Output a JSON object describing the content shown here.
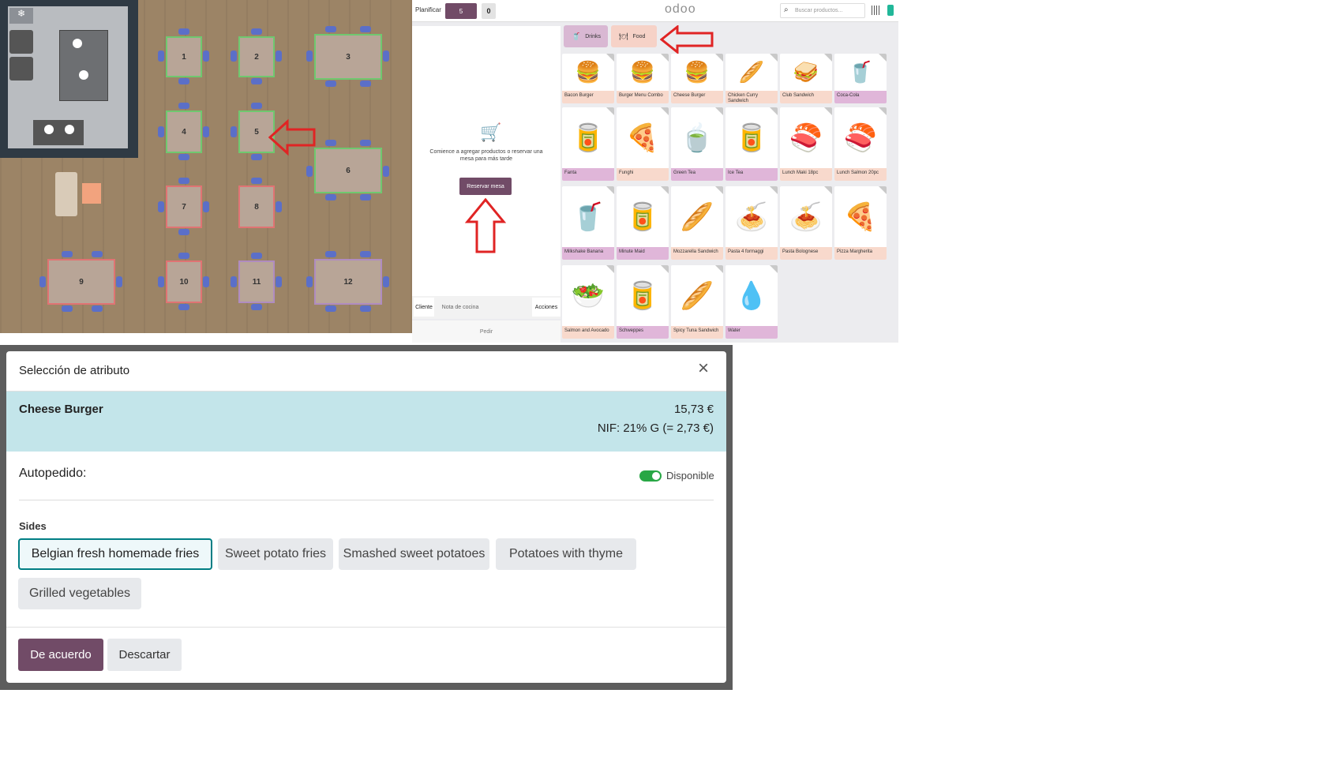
{
  "floor": {
    "tables": [
      "1",
      "2",
      "3",
      "4",
      "5",
      "6",
      "7",
      "8",
      "9",
      "10",
      "11",
      "12"
    ]
  },
  "pos": {
    "header": {
      "plan_label": "Planificar",
      "table_badge": "5",
      "counter_badge": "0",
      "logo": "odoo",
      "search_placeholder": "Buscar productos..."
    },
    "categories": [
      "Drinks",
      "Food"
    ],
    "empty_cart": {
      "message": "Comience a agregar productos o reservar una mesa para más tarde",
      "reserve_button": "Reservar mesa"
    },
    "actions": {
      "customer": "Cliente",
      "kitchen_note": "Nota de cocina",
      "actions": "Acciones",
      "order": "Pedir"
    },
    "products": [
      {
        "name": "Bacon Burger",
        "color": "#f8d9cc",
        "icon": "🍔"
      },
      {
        "name": "Burger Menu Combo",
        "color": "#f8d9cc",
        "icon": "🍔"
      },
      {
        "name": "Cheese Burger",
        "color": "#f8d9cc",
        "icon": "🍔"
      },
      {
        "name": "Chicken Curry Sandwich",
        "color": "#f8d9cc",
        "icon": "🥖"
      },
      {
        "name": "Club Sandwich",
        "color": "#f8d9cc",
        "icon": "🥪"
      },
      {
        "name": "Coca-Cola",
        "color": "#e0b6d9",
        "icon": "🥤"
      },
      {
        "name": "Fanta",
        "color": "#e0b6d9",
        "icon": "🥫"
      },
      {
        "name": "Funghi",
        "color": "#f8d9cc",
        "icon": "🍕"
      },
      {
        "name": "Green Tea",
        "color": "#e0b6d9",
        "icon": "🍵"
      },
      {
        "name": "Ice Tea",
        "color": "#e0b6d9",
        "icon": "🥫"
      },
      {
        "name": "Lunch Maki 18pc",
        "color": "#f8d9cc",
        "icon": "🍣"
      },
      {
        "name": "Lunch Salmon 20pc",
        "color": "#f8d9cc",
        "icon": "🍣"
      },
      {
        "name": "Milkshake Banana",
        "color": "#e0b6d9",
        "icon": "🥤"
      },
      {
        "name": "Minute Maid",
        "color": "#e0b6d9",
        "icon": "🥫"
      },
      {
        "name": "Mozzarella Sandwich",
        "color": "#f8d9cc",
        "icon": "🥖"
      },
      {
        "name": "Pasta 4 formaggi",
        "color": "#f8d9cc",
        "icon": "🍝"
      },
      {
        "name": "Pasta Bolognese",
        "color": "#f8d9cc",
        "icon": "🍝"
      },
      {
        "name": "Pizza Margherita",
        "color": "#f8d9cc",
        "icon": "🍕"
      },
      {
        "name": "Salmon and Avocado",
        "color": "#f8d9cc",
        "icon": "🥗"
      },
      {
        "name": "Schweppes",
        "color": "#e0b6d9",
        "icon": "🥫"
      },
      {
        "name": "Spicy Tuna Sandwich",
        "color": "#f8d9cc",
        "icon": "🥖"
      },
      {
        "name": "Water",
        "color": "#e0b6d9",
        "icon": "💧"
      }
    ]
  },
  "dialog": {
    "title": "Selección de atributo",
    "product_name": "Cheese Burger",
    "price": "15,73 €",
    "tax": "NIF: 21% G (= 2,73 €)",
    "self_order_label": "Autopedido:",
    "available_label": "Disponible",
    "sides_label": "Sides",
    "sides": [
      "Belgian fresh homemade fries",
      "Sweet potato fries",
      "Smashed sweet potatoes",
      "Potatoes with thyme",
      "Grilled vegetables"
    ],
    "ok_button": "De acuerdo",
    "discard_button": "Descartar"
  },
  "colors": {
    "primary": "#714b67",
    "teal": "#017e84",
    "header_band": "#c3e5ea",
    "toggle_green": "#28a745",
    "arrow_red": "#e02424"
  }
}
